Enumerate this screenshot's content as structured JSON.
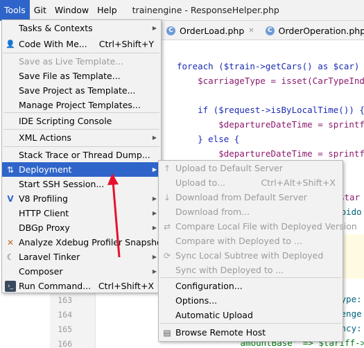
{
  "menubar": {
    "items": [
      {
        "label": "Tools"
      },
      {
        "label": "Git"
      },
      {
        "label": "Window"
      },
      {
        "label": "Help"
      }
    ],
    "window_title": "trainengine - ResponseHelper.php"
  },
  "tabs": [
    {
      "label": "OrderLoad.php"
    },
    {
      "label": "OrderOperation.php"
    }
  ],
  "gutter": {
    "lines": [
      "163",
      "164",
      "165",
      "166"
    ]
  },
  "code": {
    "lines": [
      "foreach ($train->getCars() as $car) {",
      "    $carriageType = isset(CarTypeIndex:",
      "",
      "    if ($request->isByLocalTime()) {",
      "        $departureDateTime = sprintf('%",
      "    } else {",
      "        $departureDateTime = sprintf('%"
    ],
    "right_fragments": [
      "$tar",
      "rbido",
      "Type:",
      "senge",
      "ency:"
    ],
    "bottom_line": "'amountBase' => $tariff->get"
  },
  "tools_menu": {
    "items": [
      {
        "label": "Tasks & Contexts",
        "shortcut": "",
        "submenu": true,
        "disabled": false
      },
      {
        "label": "Code With Me...",
        "shortcut": "Ctrl+Shift+Y",
        "icon": "person-icon",
        "disabled": false
      },
      {
        "label": "Save as Live Template...",
        "shortcut": "",
        "disabled": true
      },
      {
        "label": "Save File as Template...",
        "shortcut": "",
        "disabled": false
      },
      {
        "label": "Save Project as Template...",
        "shortcut": "",
        "disabled": false
      },
      {
        "label": "Manage Project Templates...",
        "shortcut": "",
        "disabled": false
      },
      {
        "label": "IDE Scripting Console",
        "shortcut": "",
        "disabled": false
      },
      {
        "label": "XML Actions",
        "shortcut": "",
        "submenu": true,
        "disabled": false
      },
      {
        "label": "Stack Trace or Thread Dump...",
        "shortcut": "",
        "disabled": false
      },
      {
        "label": "Deployment",
        "shortcut": "",
        "submenu": true,
        "selected": true,
        "icon": "deployment-icon"
      },
      {
        "label": "Start SSH Session...",
        "shortcut": "",
        "disabled": false
      },
      {
        "label": "V8 Profiling",
        "shortcut": "",
        "submenu": true,
        "icon": "v8-icon"
      },
      {
        "label": "HTTP Client",
        "shortcut": "",
        "submenu": true
      },
      {
        "label": "DBGp Proxy",
        "shortcut": "",
        "submenu": true
      },
      {
        "label": "Analyze Xdebug Profiler Snapshot...",
        "shortcut": "",
        "icon": "xdebug-icon"
      },
      {
        "label": "Laravel Tinker",
        "shortcut": "",
        "submenu": true,
        "icon": "tinker-icon"
      },
      {
        "label": "Composer",
        "shortcut": "",
        "submenu": true
      },
      {
        "label": "Run Command...",
        "shortcut": "Ctrl+Shift+X",
        "icon": "terminal-icon"
      }
    ]
  },
  "deployment_menu": {
    "items": [
      {
        "label": "Upload to Default Server",
        "shortcut": "",
        "disabled": true,
        "icon": "upload-icon"
      },
      {
        "label": "Upload to...",
        "shortcut": "Ctrl+Alt+Shift+X",
        "disabled": true
      },
      {
        "label": "Download from Default Server",
        "shortcut": "",
        "disabled": true,
        "icon": "download-icon"
      },
      {
        "label": "Download from...",
        "shortcut": "",
        "disabled": true
      },
      {
        "label": "Compare Local File with Deployed Version",
        "shortcut": "",
        "disabled": true,
        "icon": "compare-icon"
      },
      {
        "label": "Compare with Deployed to ...",
        "shortcut": "",
        "disabled": true
      },
      {
        "label": "Sync Local Subtree with Deployed",
        "shortcut": "",
        "disabled": true,
        "icon": "sync-icon"
      },
      {
        "label": "Sync with Deployed to ...",
        "shortcut": "",
        "disabled": true
      },
      {
        "label": "Configuration...",
        "shortcut": "",
        "disabled": false
      },
      {
        "label": "Options...",
        "shortcut": "",
        "disabled": false
      },
      {
        "label": "Automatic Upload",
        "shortcut": "",
        "disabled": false
      },
      {
        "label": "Browse Remote Host",
        "shortcut": "",
        "disabled": false,
        "icon": "remote-host-icon"
      }
    ]
  },
  "colors": {
    "selection": "#2f65ca",
    "annotation_arrow": "#e8112d",
    "menu_bg": "#f2f2f2"
  }
}
